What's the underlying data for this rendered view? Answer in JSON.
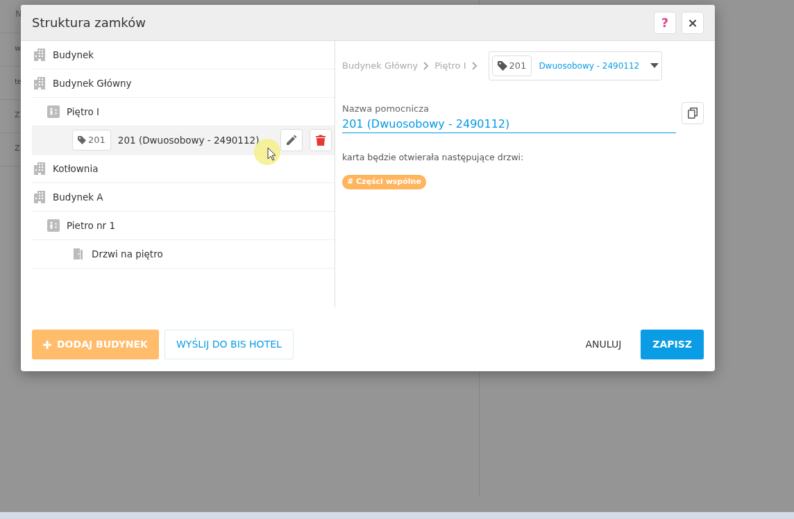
{
  "background": {
    "header": "N",
    "rows": [
      "w",
      "te",
      "Z",
      "Z"
    ]
  },
  "dialog": {
    "title": "Struktura zamków",
    "help_button": "?",
    "close_button": "×"
  },
  "tree": [
    {
      "kind": "building",
      "label": "Budynek",
      "selected": false
    },
    {
      "kind": "building",
      "label": "Budynek Główny",
      "selected": false,
      "children": [
        {
          "kind": "floor",
          "label": "Piętro I",
          "selected": false,
          "children": [
            {
              "kind": "room",
              "tag": "201",
              "label": "201 (Dwuosobowy - 2490112)",
              "selected": true
            }
          ]
        }
      ]
    },
    {
      "kind": "building",
      "label": "Kotłownia",
      "selected": false
    },
    {
      "kind": "building",
      "label": "Budynek A",
      "selected": false,
      "children": [
        {
          "kind": "floor",
          "label": "Pietro nr 1",
          "selected": false,
          "children": [
            {
              "kind": "door",
              "label": "Drzwi na piętro",
              "selected": false
            }
          ]
        }
      ]
    }
  ],
  "breadcrumb": [
    "Budynek Główny",
    "Piętro I"
  ],
  "room_select": {
    "tag": "201",
    "value": "Dwuosobowy - 2490112"
  },
  "name_field": {
    "label": "Nazwa pomocnicza",
    "value": "201 (Dwuosobowy - 2490112)"
  },
  "doors_label": "karta będzie otwierała następujące drzwi:",
  "doors": [
    {
      "icon": "#",
      "label": "Części wspólne",
      "color": "#ffb55e"
    }
  ],
  "footer": {
    "add_building": "DODAJ BUDYNEK",
    "send": "WYŚLIJ DO BIS HOTEL",
    "cancel": "ANULUJ",
    "save": "ZAPISZ"
  }
}
